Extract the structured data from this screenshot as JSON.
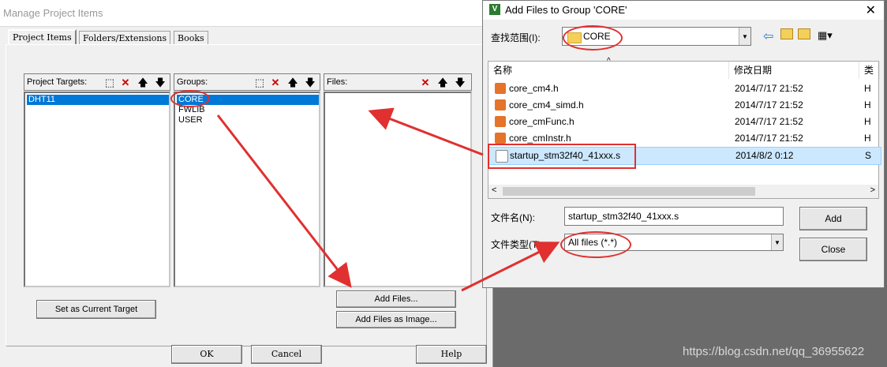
{
  "manage": {
    "title": "Manage Project Items",
    "tabs": [
      "Project Items",
      "Folders/Extensions",
      "Books"
    ],
    "targets_label": "Project Targets:",
    "targets": [
      "DHT11"
    ],
    "groups_label": "Groups:",
    "groups": [
      "CORE",
      "FWLIB",
      "USER"
    ],
    "files_label": "Files:",
    "set_current_label": "Set as Current Target",
    "add_files_label": "Add Files...",
    "add_files_image_label": "Add Files as Image...",
    "ok_label": "OK",
    "cancel_label": "Cancel",
    "help_label": "Help"
  },
  "addfiles": {
    "title": "Add Files to Group 'CORE'",
    "lookin_label": "查找范围(I):",
    "lookin_value": "CORE",
    "col_name": "名称",
    "col_date": "修改日期",
    "col_type": "类",
    "files": [
      {
        "name": "core_cm4.h",
        "date": "2014/7/17 21:52",
        "type": "H"
      },
      {
        "name": "core_cm4_simd.h",
        "date": "2014/7/17 21:52",
        "type": "H"
      },
      {
        "name": "core_cmFunc.h",
        "date": "2014/7/17 21:52",
        "type": "H"
      },
      {
        "name": "core_cmInstr.h",
        "date": "2014/7/17 21:52",
        "type": "H"
      },
      {
        "name": "startup_stm32f40_41xxx.s",
        "date": "2014/8/2 0:12",
        "type": "S"
      }
    ],
    "filename_label": "文件名(N):",
    "filename_value": "startup_stm32f40_41xxx.s",
    "filetype_label": "文件类型(T):",
    "filetype_value": "All files (*.*)",
    "add_label": "Add",
    "close_label": "Close"
  },
  "watermark": "https://blog.csdn.net/qq_36955622",
  "colors": {
    "selection": "#0078d7",
    "annotation": "#e03030"
  }
}
